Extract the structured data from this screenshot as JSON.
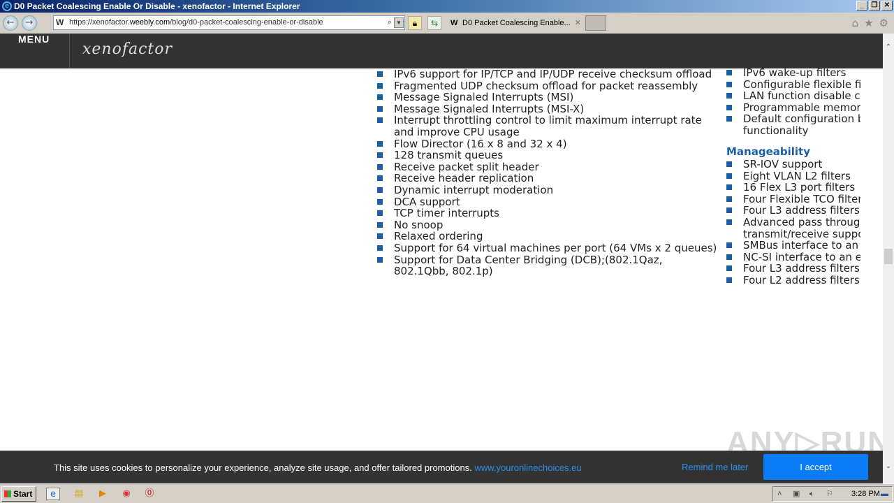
{
  "window": {
    "title": "D0 Packet Coalescing Enable Or Disable - xenofactor - Internet Explorer"
  },
  "browser": {
    "url_prefix": "https://xenofactor.",
    "url_domain": "weebly.com",
    "url_path": "/blog/d0-packet-coalescing-enable-or-disable",
    "tab_title": "D0 Packet Coalescing Enable...",
    "icons": [
      "back-icon",
      "forward-icon",
      "search-icon",
      "lock-icon",
      "refresh-icon",
      "home-icon",
      "star-icon",
      "gear-icon"
    ]
  },
  "site": {
    "menu_label": "MENU",
    "logo": "xenofactor"
  },
  "features_left": [
    "IPv6 support for IP/TCP and IP/UDP receive checksum offload",
    "Fragmented UDP checksum offload for packet reassembly",
    "Message Signaled Interrupts (MSI)",
    "Message Signaled Interrupts (MSI-X)",
    "Interrupt throttling control to limit maximum interrupt rate and improve CPU usage",
    "Flow Director (16 x 8 and 32 x 4)",
    "128 transmit queues",
    "Receive packet split header",
    "Receive header replication",
    "Dynamic interrupt moderation",
    "DCA support",
    "TCP timer interrupts",
    "No snoop",
    "Relaxed ordering",
    "Support for 64 virtual machines per port (64 VMs x 2 queues)",
    "Support for Data Center Bridging (DCB);(802.1Qaz, 802.1Qbb, 802.1p)"
  ],
  "features_right_top": [
    "IPv6 wake-up filters",
    "Configurable flexible fil",
    "LAN function disable ca",
    "Programmable memory",
    "Default configuration b"
  ],
  "features_right_top_cont": "functionality",
  "manageability": {
    "heading": "Manageability",
    "items": [
      "SR-IOV support",
      "Eight VLAN L2 filters",
      "16 Flex L3 port filters",
      "Four Flexible TCO filter",
      "Four L3 address filters",
      "Advanced pass through",
      "SMBus interface to an e",
      "NC-SI interface to an e",
      "Four L3 address filters",
      "Four L2 address filters"
    ],
    "item5_cont": "transmit/receive suppo"
  },
  "cookie": {
    "message": "This site uses cookies to personalize your experience, analyze site usage, and offer tailored promotions.",
    "link": "www.youronlinechoices.eu",
    "remind": "Remind me later",
    "accept": "I accept"
  },
  "watermark": "ANY RUN",
  "taskbar": {
    "start": "Start",
    "clock": "3:28 PM"
  }
}
